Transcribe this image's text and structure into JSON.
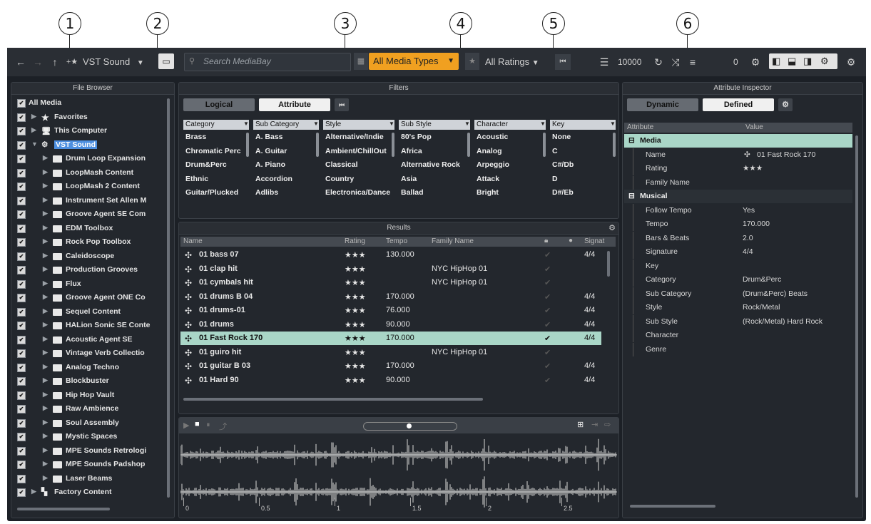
{
  "callouts": [
    "1",
    "2",
    "3",
    "4",
    "5",
    "6"
  ],
  "toolbar": {
    "back_icon": "arrow-left-icon",
    "location": "VST Sound",
    "search_placeholder": "Search MediaBay",
    "media_types": "All Media Types",
    "ratings": "All Ratings",
    "result_count": "10000",
    "preview_value": "0",
    "accent": "#f0a020"
  },
  "file_browser": {
    "title": "File Browser",
    "items": [
      {
        "label": "All Media",
        "level": 0
      },
      {
        "label": "Favorites",
        "level": 1
      },
      {
        "label": "This Computer",
        "level": 1
      },
      {
        "label": "VST Sound",
        "level": 1
      },
      {
        "label": "Drum Loop Expansion",
        "level": 2
      },
      {
        "label": "LoopMash Content",
        "level": 2
      },
      {
        "label": "LoopMash 2 Content",
        "level": 2
      },
      {
        "label": "Instrument Set Allen M",
        "level": 2
      },
      {
        "label": "Groove Agent SE Com",
        "level": 2
      },
      {
        "label": "EDM Toolbox",
        "level": 2
      },
      {
        "label": "Rock Pop Toolbox",
        "level": 2
      },
      {
        "label": "Caleidoscope",
        "level": 2
      },
      {
        "label": "Production Grooves",
        "level": 2
      },
      {
        "label": "Flux",
        "level": 2
      },
      {
        "label": "Groove Agent ONE Co",
        "level": 2
      },
      {
        "label": "Sequel Content",
        "level": 2
      },
      {
        "label": "HALion Sonic SE Conte",
        "level": 2
      },
      {
        "label": "Acoustic Agent SE",
        "level": 2
      },
      {
        "label": "Vintage Verb Collectio",
        "level": 2
      },
      {
        "label": "Analog Techno",
        "level": 2
      },
      {
        "label": "Blockbuster",
        "level": 2
      },
      {
        "label": "Hip Hop Vault",
        "level": 2
      },
      {
        "label": "Raw Ambience",
        "level": 2
      },
      {
        "label": "Soul Assembly",
        "level": 2
      },
      {
        "label": "Mystic Spaces",
        "level": 2
      },
      {
        "label": "MPE Sounds Retrologi",
        "level": 2
      },
      {
        "label": "MPE Sounds Padshop",
        "level": 2
      },
      {
        "label": "Laser Beams",
        "level": 2
      },
      {
        "label": "Factory Content",
        "level": 1
      }
    ]
  },
  "filters": {
    "title": "Filters",
    "tab_logical": "Logical",
    "tab_attribute": "Attribute",
    "columns": [
      {
        "header": "Category",
        "values": [
          "Brass",
          "Chromatic Perc",
          "Drum&Perc",
          "Ethnic",
          "Guitar/Plucked"
        ]
      },
      {
        "header": "Sub Category",
        "values": [
          "A. Bass",
          "A. Guitar",
          "A. Piano",
          "Accordion",
          "Adlibs"
        ]
      },
      {
        "header": "Style",
        "values": [
          "Alternative/Indie",
          "Ambient/ChillOut",
          "Classical",
          "Country",
          "Electronica/Dance"
        ]
      },
      {
        "header": "Sub Style",
        "values": [
          "80's Pop",
          "Africa",
          "Alternative Rock",
          "Asia",
          "Ballad"
        ]
      },
      {
        "header": "Character",
        "values": [
          "Acoustic",
          "Analog",
          "Arpeggio",
          "Attack",
          "Bright"
        ]
      },
      {
        "header": "Key",
        "values": [
          "None",
          "C",
          "C#/Db",
          "D",
          "D#/Eb"
        ]
      }
    ]
  },
  "results": {
    "title": "Results",
    "headers": {
      "name": "Name",
      "rating": "Rating",
      "tempo": "Tempo",
      "family": "Family Name",
      "signature": "Signat"
    },
    "rows": [
      {
        "name": "01 bass 07",
        "rating": "★★★",
        "tempo": "130.000",
        "family": "",
        "sig": "4/4"
      },
      {
        "name": "01 clap hit",
        "rating": "★★★",
        "tempo": "",
        "family": "NYC HipHop 01",
        "sig": ""
      },
      {
        "name": "01 cymbals hit",
        "rating": "★★★",
        "tempo": "",
        "family": "NYC HipHop 01",
        "sig": ""
      },
      {
        "name": "01 drums B 04",
        "rating": "★★★",
        "tempo": "170.000",
        "family": "",
        "sig": "4/4"
      },
      {
        "name": "01 drums-01",
        "rating": "★★★",
        "tempo": "76.000",
        "family": "",
        "sig": "4/4"
      },
      {
        "name": "01 drums",
        "rating": "★★★",
        "tempo": "90.000",
        "family": "",
        "sig": "4/4"
      },
      {
        "name": "01 Fast Rock 170",
        "rating": "★★★",
        "tempo": "170.000",
        "family": "",
        "sig": "4/4",
        "selected": true
      },
      {
        "name": "01 guiro hit",
        "rating": "★★★",
        "tempo": "",
        "family": "NYC HipHop 01",
        "sig": ""
      },
      {
        "name": "01 guitar B 03",
        "rating": "★★★",
        "tempo": "170.000",
        "family": "",
        "sig": "4/4"
      },
      {
        "name": "01 Hard 90",
        "rating": "★★★",
        "tempo": "90.000",
        "family": "",
        "sig": "4/4"
      }
    ]
  },
  "previewer": {
    "ruler": [
      "0",
      "0.5",
      "1",
      "1.5",
      "2",
      "2.5"
    ]
  },
  "inspector": {
    "title": "Attribute Inspector",
    "tab_dynamic": "Dynamic",
    "tab_defined": "Defined",
    "col_attribute": "Attribute",
    "col_value": "Value",
    "groups": [
      {
        "name": "Media",
        "rows": [
          {
            "attr": "Name",
            "value": "01 Fast Rock 170"
          },
          {
            "attr": "Rating",
            "value": "★★★"
          },
          {
            "attr": "Family Name",
            "value": ""
          }
        ]
      },
      {
        "name": "Musical",
        "rows": [
          {
            "attr": "Follow Tempo",
            "value": "Yes"
          },
          {
            "attr": "Tempo",
            "value": "170.000"
          },
          {
            "attr": "Bars & Beats",
            "value": "2.0"
          },
          {
            "attr": "Signature",
            "value": "4/4"
          },
          {
            "attr": "Key",
            "value": ""
          },
          {
            "attr": "Category",
            "value": "Drum&Perc"
          },
          {
            "attr": "Sub Category",
            "value": "(Drum&Perc) Beats"
          },
          {
            "attr": "Style",
            "value": "Rock/Metal"
          },
          {
            "attr": "Sub Style",
            "value": "(Rock/Metal) Hard Rock"
          },
          {
            "attr": "Character",
            "value": ""
          },
          {
            "attr": "Genre",
            "value": ""
          }
        ]
      }
    ]
  }
}
